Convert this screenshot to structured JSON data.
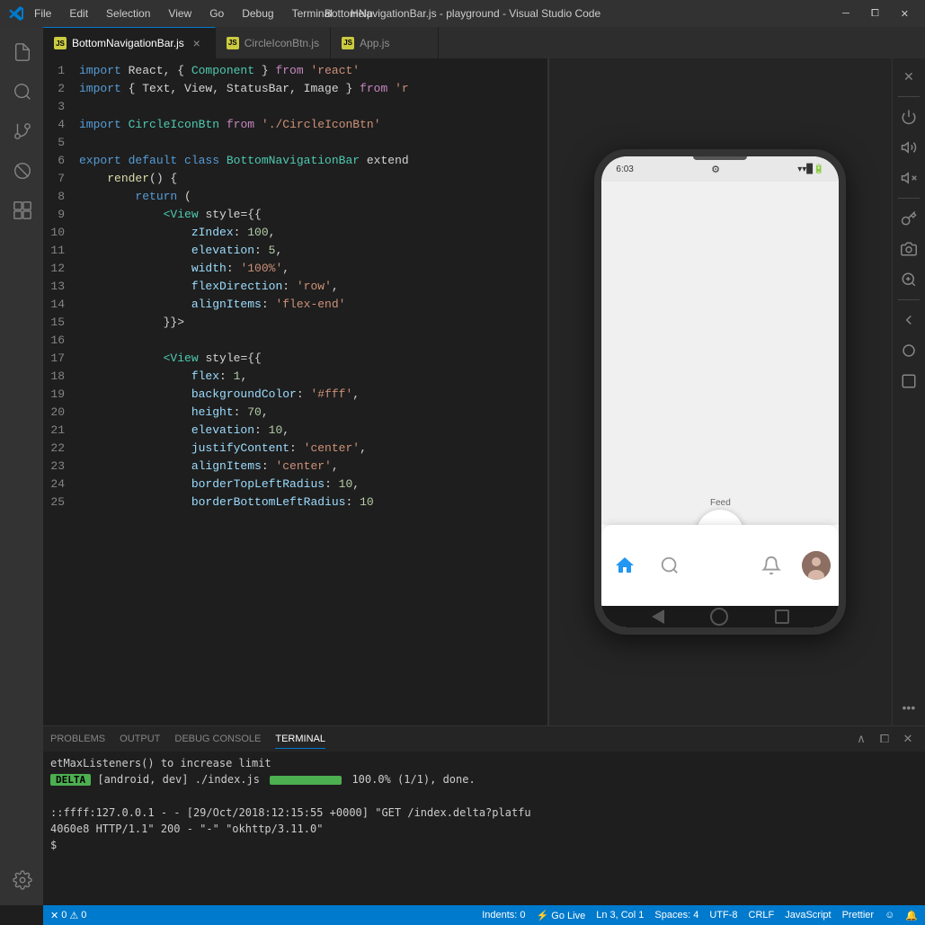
{
  "titlebar": {
    "icon": "⬡",
    "menus": [
      "File",
      "Edit",
      "Selection",
      "View",
      "Go",
      "Debug",
      "Terminal",
      "Help"
    ],
    "title": "BottomNavigationBar.js - playground - Visual Studio Code",
    "minimize": "─",
    "restore": "⧠",
    "close": "✕"
  },
  "activity": {
    "icons": [
      {
        "name": "explorer-icon",
        "symbol": "⎘",
        "active": false
      },
      {
        "name": "search-icon",
        "symbol": "🔍",
        "active": false
      },
      {
        "name": "source-control-icon",
        "symbol": "⑂",
        "active": false
      },
      {
        "name": "debug-icon",
        "symbol": "⊘",
        "active": false
      },
      {
        "name": "extensions-icon",
        "symbol": "⊞",
        "active": false
      }
    ],
    "bottom": {
      "name": "settings-icon",
      "symbol": "⚙"
    }
  },
  "tabs": [
    {
      "label": "BottomNavigationBar.js",
      "type": "js",
      "active": true,
      "closeable": true
    },
    {
      "label": "CircleIconBtn.js",
      "type": "js",
      "active": false,
      "closeable": false
    },
    {
      "label": "App.js",
      "type": "js",
      "active": false,
      "closeable": false
    }
  ],
  "code": {
    "lines": [
      {
        "num": 1,
        "tokens": [
          {
            "t": "kw",
            "v": "import"
          },
          {
            "t": "punc",
            "v": " React, { "
          },
          {
            "t": "cls",
            "v": "Component"
          },
          {
            "t": "punc",
            "v": " } "
          },
          {
            "t": "from-kw",
            "v": "from"
          },
          {
            "t": "punc",
            "v": " "
          },
          {
            "t": "str",
            "v": "'react'"
          }
        ]
      },
      {
        "num": 2,
        "tokens": [
          {
            "t": "kw",
            "v": "import"
          },
          {
            "t": "punc",
            "v": " { Text, View, StatusBar, Image } "
          },
          {
            "t": "from-kw",
            "v": "from"
          },
          {
            "t": "punc",
            "v": " "
          },
          {
            "t": "str",
            "v": "'r"
          }
        ]
      },
      {
        "num": 3,
        "tokens": []
      },
      {
        "num": 4,
        "tokens": [
          {
            "t": "kw",
            "v": "import"
          },
          {
            "t": "punc",
            "v": " "
          },
          {
            "t": "cls",
            "v": "CircleIconBtn"
          },
          {
            "t": "punc",
            "v": " "
          },
          {
            "t": "from-kw",
            "v": "from"
          },
          {
            "t": "punc",
            "v": " "
          },
          {
            "t": "str",
            "v": "'./CircleIconBtn'"
          }
        ]
      },
      {
        "num": 5,
        "tokens": []
      },
      {
        "num": 6,
        "tokens": [
          {
            "t": "kw",
            "v": "export"
          },
          {
            "t": "punc",
            "v": " "
          },
          {
            "t": "kw",
            "v": "default"
          },
          {
            "t": "punc",
            "v": " "
          },
          {
            "t": "kw",
            "v": "class"
          },
          {
            "t": "punc",
            "v": " "
          },
          {
            "t": "cls",
            "v": "BottomNavigationBar"
          },
          {
            "t": "punc",
            "v": " extend"
          }
        ]
      },
      {
        "num": 7,
        "tokens": [
          {
            "t": "punc",
            "v": "    "
          },
          {
            "t": "fn",
            "v": "render"
          },
          {
            "t": "punc",
            "v": "() {"
          }
        ]
      },
      {
        "num": 8,
        "tokens": [
          {
            "t": "punc",
            "v": "        "
          },
          {
            "t": "kw",
            "v": "return"
          },
          {
            "t": "punc",
            "v": " ("
          }
        ]
      },
      {
        "num": 9,
        "tokens": [
          {
            "t": "punc",
            "v": "            "
          },
          {
            "t": "tag",
            "v": "<View"
          },
          {
            "t": "punc",
            "v": " style={{"
          }
        ]
      },
      {
        "num": 10,
        "tokens": [
          {
            "t": "punc",
            "v": "                "
          },
          {
            "t": "prop",
            "v": "zIndex"
          },
          {
            "t": "punc",
            "v": ": "
          },
          {
            "t": "num",
            "v": "100"
          },
          {
            "t": "punc",
            "v": ","
          }
        ]
      },
      {
        "num": 11,
        "tokens": [
          {
            "t": "punc",
            "v": "                "
          },
          {
            "t": "prop",
            "v": "elevation"
          },
          {
            "t": "punc",
            "v": ": "
          },
          {
            "t": "num",
            "v": "5"
          },
          {
            "t": "punc",
            "v": ","
          }
        ]
      },
      {
        "num": 12,
        "tokens": [
          {
            "t": "punc",
            "v": "                "
          },
          {
            "t": "prop",
            "v": "width"
          },
          {
            "t": "punc",
            "v": ": "
          },
          {
            "t": "str",
            "v": "'100%'"
          },
          {
            "t": "punc",
            "v": ","
          }
        ]
      },
      {
        "num": 13,
        "tokens": [
          {
            "t": "punc",
            "v": "                "
          },
          {
            "t": "prop",
            "v": "flexDirection"
          },
          {
            "t": "punc",
            "v": ": "
          },
          {
            "t": "str",
            "v": "'row'"
          },
          {
            "t": "punc",
            "v": ","
          }
        ]
      },
      {
        "num": 14,
        "tokens": [
          {
            "t": "punc",
            "v": "                "
          },
          {
            "t": "prop",
            "v": "alignItems"
          },
          {
            "t": "punc",
            "v": ": "
          },
          {
            "t": "str",
            "v": "'flex-end'"
          }
        ]
      },
      {
        "num": 15,
        "tokens": [
          {
            "t": "punc",
            "v": "            }}"
          },
          {
            "t": "punc",
            "v": ">"
          }
        ]
      },
      {
        "num": 16,
        "tokens": []
      },
      {
        "num": 17,
        "tokens": [
          {
            "t": "punc",
            "v": "            "
          },
          {
            "t": "tag",
            "v": "<View"
          },
          {
            "t": "punc",
            "v": " style={{"
          }
        ]
      },
      {
        "num": 18,
        "tokens": [
          {
            "t": "punc",
            "v": "                "
          },
          {
            "t": "prop",
            "v": "flex"
          },
          {
            "t": "punc",
            "v": ": "
          },
          {
            "t": "num",
            "v": "1"
          },
          {
            "t": "punc",
            "v": ","
          }
        ]
      },
      {
        "num": 19,
        "tokens": [
          {
            "t": "punc",
            "v": "                "
          },
          {
            "t": "prop",
            "v": "backgroundColor"
          },
          {
            "t": "punc",
            "v": ": "
          },
          {
            "t": "str",
            "v": "'#fff'"
          },
          {
            "t": "punc",
            "v": ","
          }
        ]
      },
      {
        "num": 20,
        "tokens": [
          {
            "t": "punc",
            "v": "                "
          },
          {
            "t": "prop",
            "v": "height"
          },
          {
            "t": "punc",
            "v": ": "
          },
          {
            "t": "num",
            "v": "70"
          },
          {
            "t": "punc",
            "v": ","
          }
        ]
      },
      {
        "num": 21,
        "tokens": [
          {
            "t": "punc",
            "v": "                "
          },
          {
            "t": "prop",
            "v": "elevation"
          },
          {
            "t": "punc",
            "v": ": "
          },
          {
            "t": "num",
            "v": "10"
          },
          {
            "t": "punc",
            "v": ","
          }
        ]
      },
      {
        "num": 22,
        "tokens": [
          {
            "t": "punc",
            "v": "                "
          },
          {
            "t": "prop",
            "v": "justifyContent"
          },
          {
            "t": "punc",
            "v": ": "
          },
          {
            "t": "str",
            "v": "'center'"
          },
          {
            "t": "punc",
            "v": ","
          }
        ]
      },
      {
        "num": 23,
        "tokens": [
          {
            "t": "punc",
            "v": "                "
          },
          {
            "t": "prop",
            "v": "alignItems"
          },
          {
            "t": "punc",
            "v": ": "
          },
          {
            "t": "str",
            "v": "'center'"
          },
          {
            "t": "punc",
            "v": ","
          }
        ]
      },
      {
        "num": 24,
        "tokens": [
          {
            "t": "punc",
            "v": "                "
          },
          {
            "t": "prop",
            "v": "borderTopLeftRadius"
          },
          {
            "t": "punc",
            "v": ": "
          },
          {
            "t": "num",
            "v": "10"
          },
          {
            "t": "punc",
            "v": ","
          }
        ]
      },
      {
        "num": 25,
        "tokens": [
          {
            "t": "punc",
            "v": "                "
          },
          {
            "t": "prop",
            "v": "borderBottomLeftRadius"
          },
          {
            "t": "punc",
            "v": ": "
          },
          {
            "t": "num",
            "v": "10"
          }
        ]
      }
    ]
  },
  "phone": {
    "time": "6:03",
    "status_icons": "▾▾▉",
    "feed_label": "Feed",
    "fab_plus": "+",
    "nav_items": [
      "home",
      "search",
      "add",
      "notifications",
      "profile"
    ]
  },
  "right_toolbar": {
    "buttons": [
      "✕",
      "⏻",
      "🔊",
      "🔇",
      "◇",
      "✏",
      "📷",
      "🔍",
      "◁",
      "○",
      "□",
      "..."
    ]
  },
  "panel": {
    "tabs": [
      "PROBLEMS",
      "OUTPUT",
      "DEBUG CONSOLE",
      "TERMINAL"
    ],
    "active_tab": "TERMINAL",
    "terminal_lines": [
      "etMaxListeners() to increase limit",
      "[android, dev] ./index.js   100.0% (1/1), done.",
      "",
      "::ffff:127.0.0.1 - - [29/Oct/2018:12:15:55 +0000] \"GET /index.delta?platfu",
      "4060e8 HTTP/1.1\" 200 - \"-\" \"okhttp/3.11.0\"",
      "$ "
    ],
    "delta_label": "DELTA"
  },
  "statusbar": {
    "errors": "0",
    "warnings": "0",
    "branch": "Indents: 0",
    "live": "⚡ Go Live",
    "cursor": "Ln 3, Col 1",
    "spaces": "Spaces: 4",
    "encoding": "UTF-8",
    "line_ending": "CRLF",
    "language": "JavaScript",
    "prettier": "Prettier",
    "smiley": "☺",
    "bell": "🔔"
  }
}
